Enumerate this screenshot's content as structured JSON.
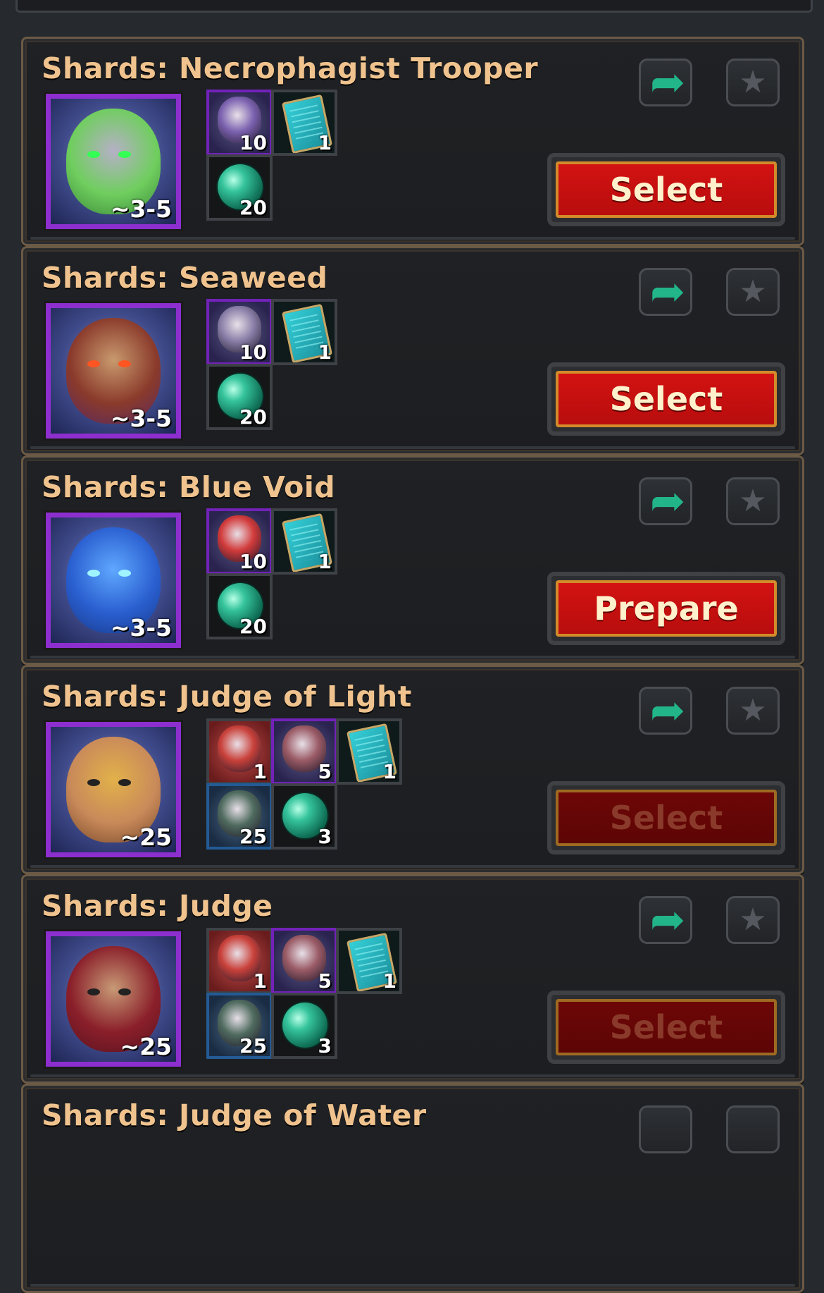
{
  "cards": [
    {
      "title": "Shards: Necrophagist Trooper",
      "portrait": {
        "range": "~3-5",
        "palette": [
          "#b6b0c6",
          "#6fce5e",
          "#3c8a3a"
        ],
        "eye": "#33ff55"
      },
      "items": [
        {
          "kind": "shard",
          "frame": "purple",
          "qty": "10",
          "color": "#7c62b0"
        },
        {
          "kind": "scroll",
          "frame": "plain",
          "qty": "1"
        },
        {
          "kind": "orb",
          "frame": "plain",
          "qty": "20"
        }
      ],
      "share_icon": "share-arrow-icon",
      "fav_icon": "star-icon",
      "action": {
        "label": "Select",
        "enabled": true
      }
    },
    {
      "title": "Shards: Seaweed",
      "portrait": {
        "range": "~3-5",
        "palette": [
          "#c99a6e",
          "#8a3a2b",
          "#5a2a5f"
        ],
        "eye": "#ff5522"
      },
      "items": [
        {
          "kind": "shard",
          "frame": "purple",
          "qty": "10",
          "color": "#8a7fa8"
        },
        {
          "kind": "scroll",
          "frame": "plain",
          "qty": "1"
        },
        {
          "kind": "orb",
          "frame": "plain",
          "qty": "20"
        }
      ],
      "share_icon": "share-arrow-icon",
      "fav_icon": "star-icon",
      "action": {
        "label": "Select",
        "enabled": true
      }
    },
    {
      "title": "Shards: Blue Void",
      "portrait": {
        "range": "~3-5",
        "palette": [
          "#5fa8ff",
          "#2a5fd0",
          "#173a8a"
        ],
        "eye": "#9ff4ff"
      },
      "items": [
        {
          "kind": "shard",
          "frame": "purple",
          "qty": "10",
          "color": "#d23b3b"
        },
        {
          "kind": "scroll",
          "frame": "plain",
          "qty": "1"
        },
        {
          "kind": "orb",
          "frame": "plain",
          "qty": "20"
        }
      ],
      "share_icon": "share-arrow-icon",
      "fav_icon": "star-icon",
      "action": {
        "label": "Prepare",
        "enabled": true
      }
    },
    {
      "title": "Shards: Judge of Light",
      "portrait": {
        "range": "~25",
        "palette": [
          "#e2b14a",
          "#c98a5a",
          "#7a4a2a"
        ],
        "eye": "#222222"
      },
      "items": [
        {
          "kind": "shard",
          "frame": "red",
          "qty": "1",
          "color": "#c9413a"
        },
        {
          "kind": "shard",
          "frame": "purple",
          "qty": "5",
          "color": "#9a5b66"
        },
        {
          "kind": "scroll",
          "frame": "plain",
          "qty": "1"
        },
        {
          "kind": "shard",
          "frame": "blue",
          "qty": "25",
          "color": "#4f6b5f"
        },
        {
          "kind": "orb",
          "frame": "plain",
          "qty": "3"
        }
      ],
      "share_icon": "share-arrow-icon",
      "fav_icon": "star-icon",
      "action": {
        "label": "Select",
        "enabled": false
      }
    },
    {
      "title": "Shards: Judge",
      "portrait": {
        "range": "~25",
        "palette": [
          "#c89a76",
          "#8a1f2a",
          "#5a1320"
        ],
        "eye": "#222222"
      },
      "items": [
        {
          "kind": "shard",
          "frame": "red",
          "qty": "1",
          "color": "#c9413a"
        },
        {
          "kind": "shard",
          "frame": "purple",
          "qty": "5",
          "color": "#9a5b66"
        },
        {
          "kind": "scroll",
          "frame": "plain",
          "qty": "1"
        },
        {
          "kind": "shard",
          "frame": "blue",
          "qty": "25",
          "color": "#4f6b5f"
        },
        {
          "kind": "orb",
          "frame": "plain",
          "qty": "3"
        }
      ],
      "share_icon": "share-arrow-icon",
      "fav_icon": "star-icon",
      "action": {
        "label": "Select",
        "enabled": false
      }
    },
    {
      "title": "Shards: Judge of Water",
      "partial": true
    }
  ]
}
